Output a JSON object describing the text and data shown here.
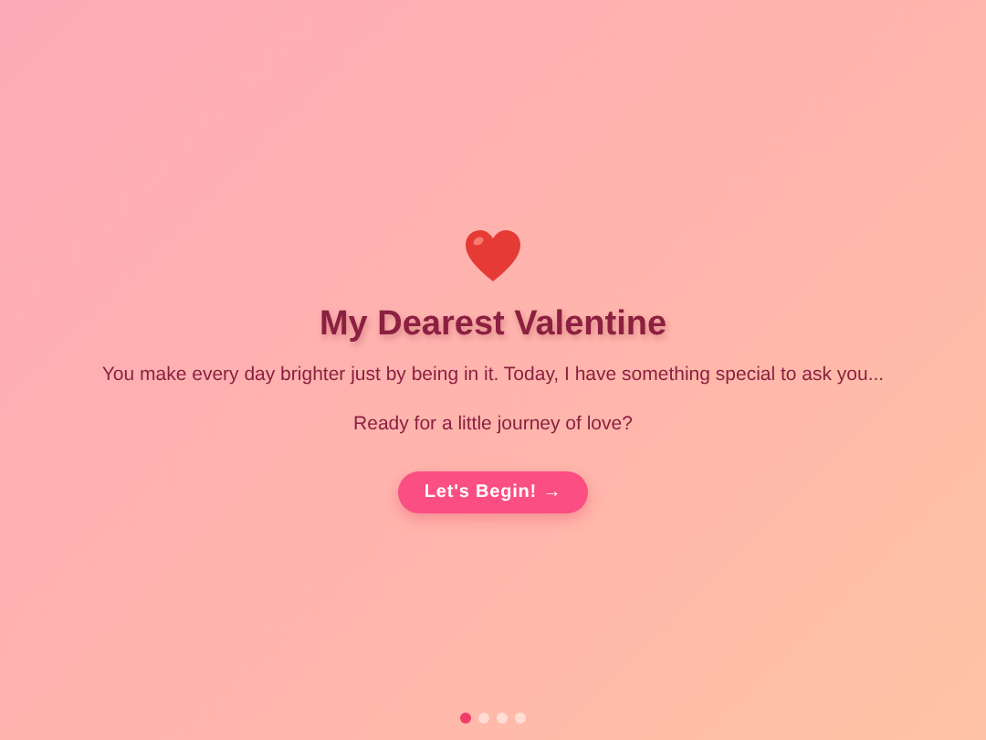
{
  "title": "My Dearest Valentine",
  "message": "You make every day brighter just by being in it. Today, I have something special to ask you...",
  "question": "Ready for a little journey of love?",
  "button": "Let's Begin! →",
  "steps": [
    {
      "selected": true
    },
    {
      "selected": false
    },
    {
      "selected": false
    },
    {
      "selected": false
    }
  ]
}
